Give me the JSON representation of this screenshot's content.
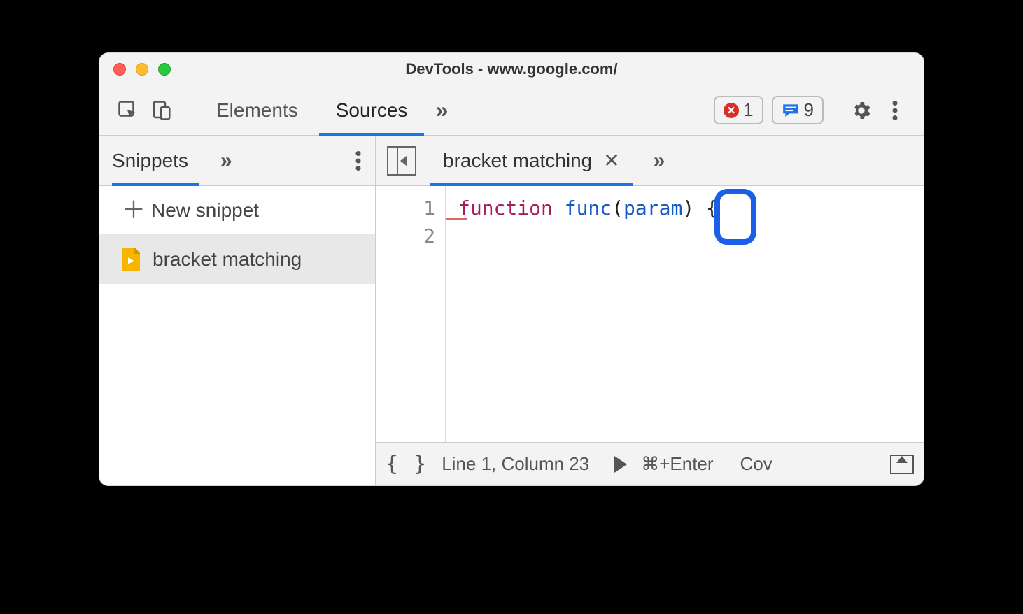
{
  "window": {
    "title": "DevTools - www.google.com/"
  },
  "toolbar": {
    "tabs": {
      "elements": "Elements",
      "sources": "Sources"
    },
    "errors_count": "1",
    "messages_count": "9"
  },
  "sidebar": {
    "tab_label": "Snippets",
    "new_snippet_label": "New snippet",
    "items": [
      {
        "label": "bracket matching"
      }
    ]
  },
  "editor": {
    "tab_label": "bracket matching",
    "line_numbers": [
      "1",
      "2"
    ],
    "code": {
      "keyword": "function",
      "func_name": "func",
      "open_paren": "(",
      "param": "param",
      "close_paren": ")",
      "space": " ",
      "brace": "{"
    }
  },
  "statusbar": {
    "format_braces": "{ }",
    "position": "Line 1, Column 23",
    "run_hint": "⌘+Enter",
    "coverage": "Cov"
  }
}
